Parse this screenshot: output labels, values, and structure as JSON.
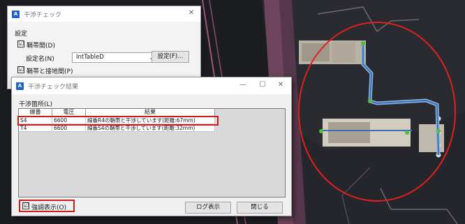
{
  "dialog_main": {
    "title": "干渉チェック",
    "section_label": "設定",
    "checkbox_sleeve": {
      "label": "鞘帯間(D)",
      "checked": true
    },
    "setting_name_label": "設定名(N)",
    "setting_name_value": "IntTableD",
    "settings_button": "設定(F)...",
    "checkbox_sleeve_ground": {
      "label": "鞘帯と接地間(P)",
      "checked": true
    }
  },
  "dialog_result": {
    "title": "干渉チェック結果",
    "list_label": "干渉箇所(L)",
    "columns": [
      "線番",
      "電圧",
      "結果"
    ],
    "rows": [
      {
        "wire": "S4",
        "voltage": "6600",
        "result": "線番R4の鞘帯と干渉しています(距離:67mm)",
        "selected": true
      },
      {
        "wire": "T4",
        "voltage": "6600",
        "result": "線番S4の鞘帯と干渉しています(距離:32mm)",
        "selected": false
      }
    ],
    "highlight_checkbox": {
      "label": "強調表示(O)",
      "checked": true
    },
    "log_button": "ログ表示",
    "close_button": "閉じる",
    "minimize": "—",
    "maximize": "☐",
    "close_x": "✕"
  },
  "window_close_x": "✕",
  "check_mark": "☑",
  "colors": {
    "highlight_red": "#d11a1a",
    "circle_red": "#e02020",
    "cable_blue": "#4f86c6",
    "node_green": "#4cc23a",
    "magenta_frame": "#a0567e"
  }
}
